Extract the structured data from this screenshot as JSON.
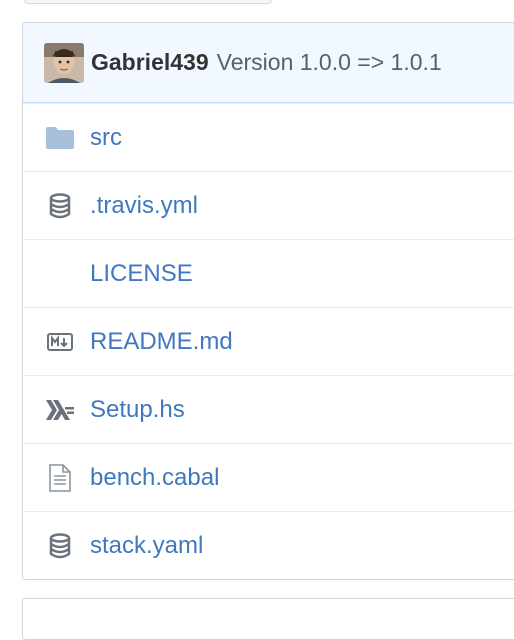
{
  "commit": {
    "author": "Gabriel439",
    "message": "Version 1.0.0 => 1.0.1"
  },
  "files": [
    {
      "name": "src",
      "icon": "folder-icon"
    },
    {
      "name": ".travis.yml",
      "icon": "database-icon"
    },
    {
      "name": "LICENSE",
      "icon": "none"
    },
    {
      "name": "README.md",
      "icon": "markdown-icon"
    },
    {
      "name": "Setup.hs",
      "icon": "haskell-icon"
    },
    {
      "name": "bench.cabal",
      "icon": "file-text-icon"
    },
    {
      "name": "stack.yaml",
      "icon": "database-icon"
    }
  ],
  "colors": {
    "link": "#4078c0",
    "header_bg": "#f1f8ff",
    "icon": "#6a737d",
    "folder": "#a5c0d8"
  }
}
